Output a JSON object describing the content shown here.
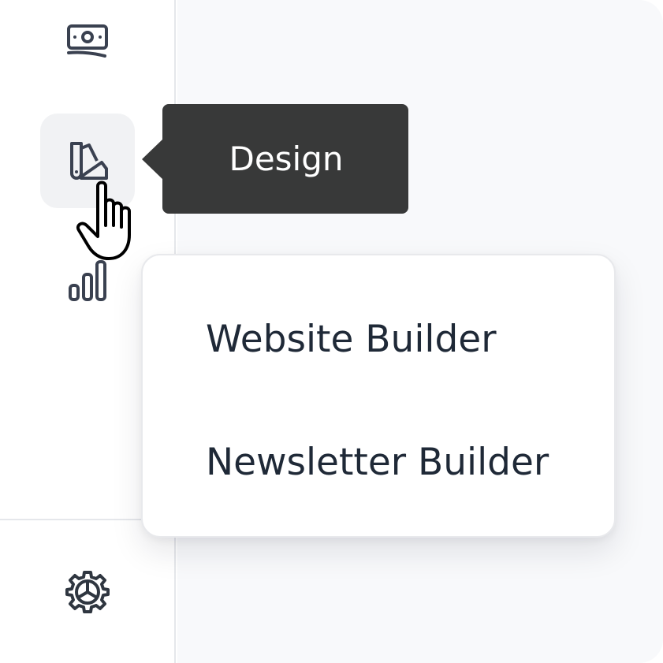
{
  "sidebar": {
    "items": [
      {
        "icon": "money-icon",
        "active": false
      },
      {
        "icon": "design-swatch-icon",
        "active": true
      },
      {
        "icon": "analytics-icon",
        "active": false
      }
    ],
    "footer_item": {
      "icon": "settings-gear-icon"
    }
  },
  "tooltip": {
    "label": "Design"
  },
  "menu": {
    "items": [
      {
        "label": "Website Builder"
      },
      {
        "label": "Newsletter Builder"
      }
    ]
  },
  "colors": {
    "icon_stroke": "#3a4150",
    "tooltip_bg": "#383939",
    "menu_text": "#1f2937",
    "main_bg": "#f8f9fb",
    "active_bg": "#f1f2f4"
  }
}
